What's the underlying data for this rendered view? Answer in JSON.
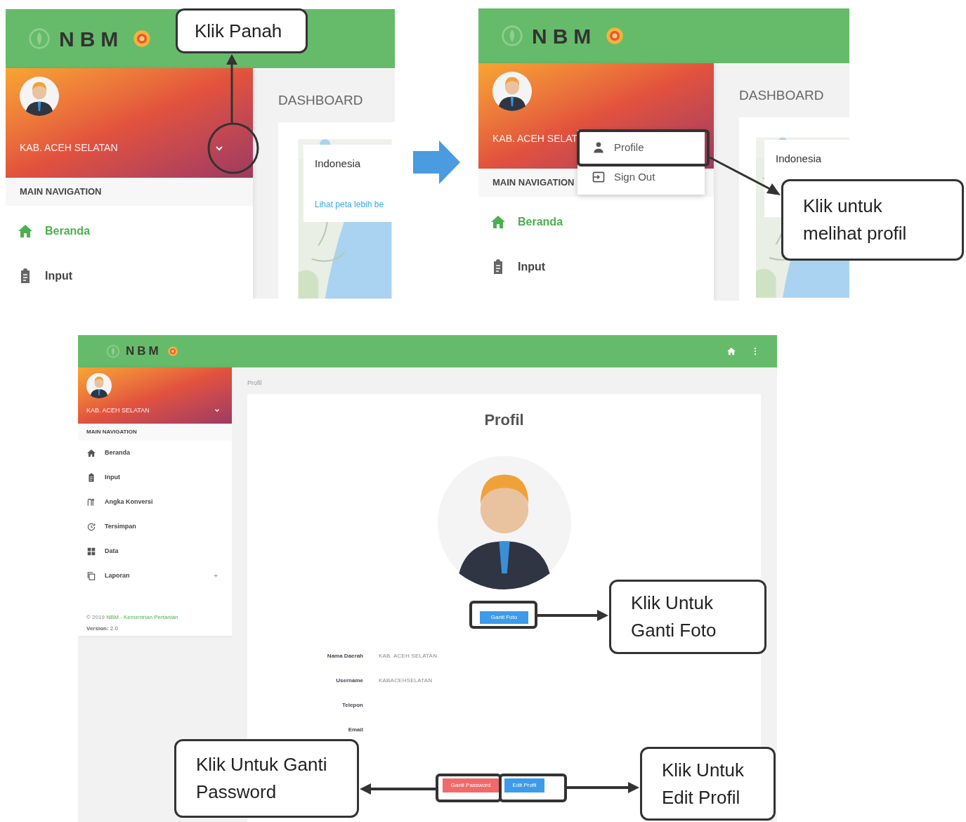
{
  "step_1": {
    "logo": "NBM",
    "user": "KAB. ACEH SELATAN",
    "nav_heading": "MAIN NAVIGATION",
    "nav": [
      {
        "kind": "home",
        "label": "Beranda",
        "selected": true
      },
      {
        "kind": "clipboard",
        "label": "Input",
        "selected": false
      }
    ],
    "page_title": "DASHBOARD",
    "map_popup": {
      "title": "Indonesia",
      "link": "Lihat peta lebih be"
    },
    "callout": "Klik Panah"
  },
  "step_2": {
    "logo": "NBM",
    "user": "KAB. ACEH SELAT",
    "nav_heading": "MAIN NAVIGATION",
    "nav": [
      {
        "kind": "home",
        "label": "Beranda",
        "selected": true
      },
      {
        "kind": "clipboard",
        "label": "Input",
        "selected": false
      }
    ],
    "menu": [
      {
        "kind": "person",
        "label": "Profile"
      },
      {
        "kind": "signout",
        "label": "Sign Out"
      }
    ],
    "page_title": "DASHBOARD",
    "map_popup": {
      "title": "Indonesia"
    },
    "callout": "Klik untuk melihat profil"
  },
  "step_3": {
    "logo": "NBM",
    "user": "KAB. ACEH SELATAN",
    "nav_heading": "MAIN NAVIGATION",
    "nav": [
      {
        "kind": "home",
        "label": "Beranda",
        "selected": false
      },
      {
        "kind": "clipboard",
        "label": "Input",
        "selected": false
      },
      {
        "kind": "convert",
        "label": "Angka Konversi",
        "selected": false
      },
      {
        "kind": "history",
        "label": "Tersimpan",
        "selected": false
      },
      {
        "kind": "grid",
        "label": "Data",
        "selected": false
      },
      {
        "kind": "copy",
        "label": "Laporan",
        "selected": false,
        "expander": "+"
      }
    ],
    "footer": {
      "copyright": "© 2019",
      "link": "NBM - Kementrian Pertanian",
      "version": "**Version:** 2.0"
    },
    "breadcrumb": "Profil",
    "title": "Profil",
    "photo_button": "Ganti Foto",
    "fields": [
      {
        "label": "Nama Daerah",
        "value": "KAB. ACEH SELATAN"
      },
      {
        "label": "Username",
        "value": "KABACEHSELATAN"
      },
      {
        "label": "Telepon"
      },
      {
        "label": "Email"
      }
    ],
    "buttons": [
      {
        "kind": "danger",
        "label": "Ganti Password"
      },
      {
        "kind": "primary",
        "label": "Edit Profil"
      }
    ],
    "callouts": [
      "Klik Untuk Ganti Foto",
      "Klik Untuk Ganti Password",
      "Klik Untuk Edit Profil"
    ]
  }
}
